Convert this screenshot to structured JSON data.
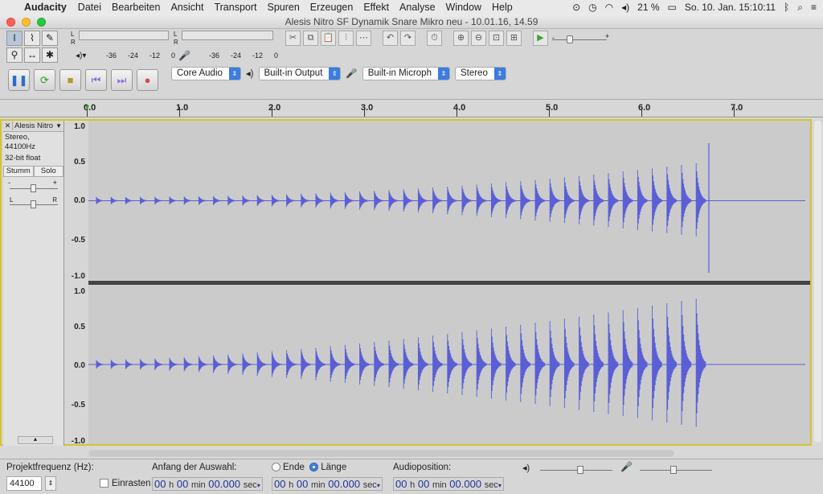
{
  "menubar": {
    "app": "Audacity",
    "items": [
      "Datei",
      "Bearbeiten",
      "Ansicht",
      "Transport",
      "Spuren",
      "Erzeugen",
      "Effekt",
      "Analyse",
      "Window",
      "Help"
    ],
    "battery": "21 %",
    "clock": "So. 10. Jan.  15:10:11"
  },
  "window": {
    "title": "Alesis Nitro SF Dynamik Snare Mikro neu - 10.01.16, 14.59"
  },
  "meters": {
    "record_scale": [
      "-36",
      "-24",
      "-12",
      "0"
    ],
    "playback_scale": [
      "-36",
      "-24",
      "-12",
      "0"
    ],
    "channel_l": "L",
    "channel_r": "R"
  },
  "devices": {
    "host": "Core Audio",
    "output": "Built-in Output",
    "input": "Built-in Microph",
    "channels": "Stereo"
  },
  "ruler": {
    "labels": [
      "0.0",
      "1.0",
      "2.0",
      "3.0",
      "4.0",
      "5.0",
      "6.0",
      "7.0"
    ]
  },
  "track": {
    "name": "Alesis Nitro",
    "format": "Stereo, 44100Hz",
    "bitdepth": "32-bit float",
    "mute": "Stumm",
    "solo": "Solo",
    "gain_minus": "-",
    "gain_plus": "+",
    "pan_l": "L",
    "pan_r": "R",
    "scale": [
      "1.0",
      "0.5",
      "0.0",
      "-0.5",
      "-1.0"
    ]
  },
  "selection": {
    "rate_label": "Projektfrequenz (Hz):",
    "rate_value": "44100",
    "snap_label": "Einrasten",
    "start_label": "Anfang der Auswahl:",
    "end_label": "Ende",
    "length_label": "Länge",
    "audio_pos_label": "Audioposition:",
    "start_time": {
      "h": "00",
      "min": "00",
      "sec": "00.000"
    },
    "end_time": {
      "h": "00",
      "min": "00",
      "sec": "00.000"
    },
    "audio_time": {
      "h": "00",
      "min": "00",
      "sec": "00.000"
    },
    "unit_h": "h",
    "unit_min": "min",
    "unit_sec": "sec"
  },
  "colors": {
    "waveform": "#5a5fd6",
    "track_border": "#d5c52d"
  }
}
